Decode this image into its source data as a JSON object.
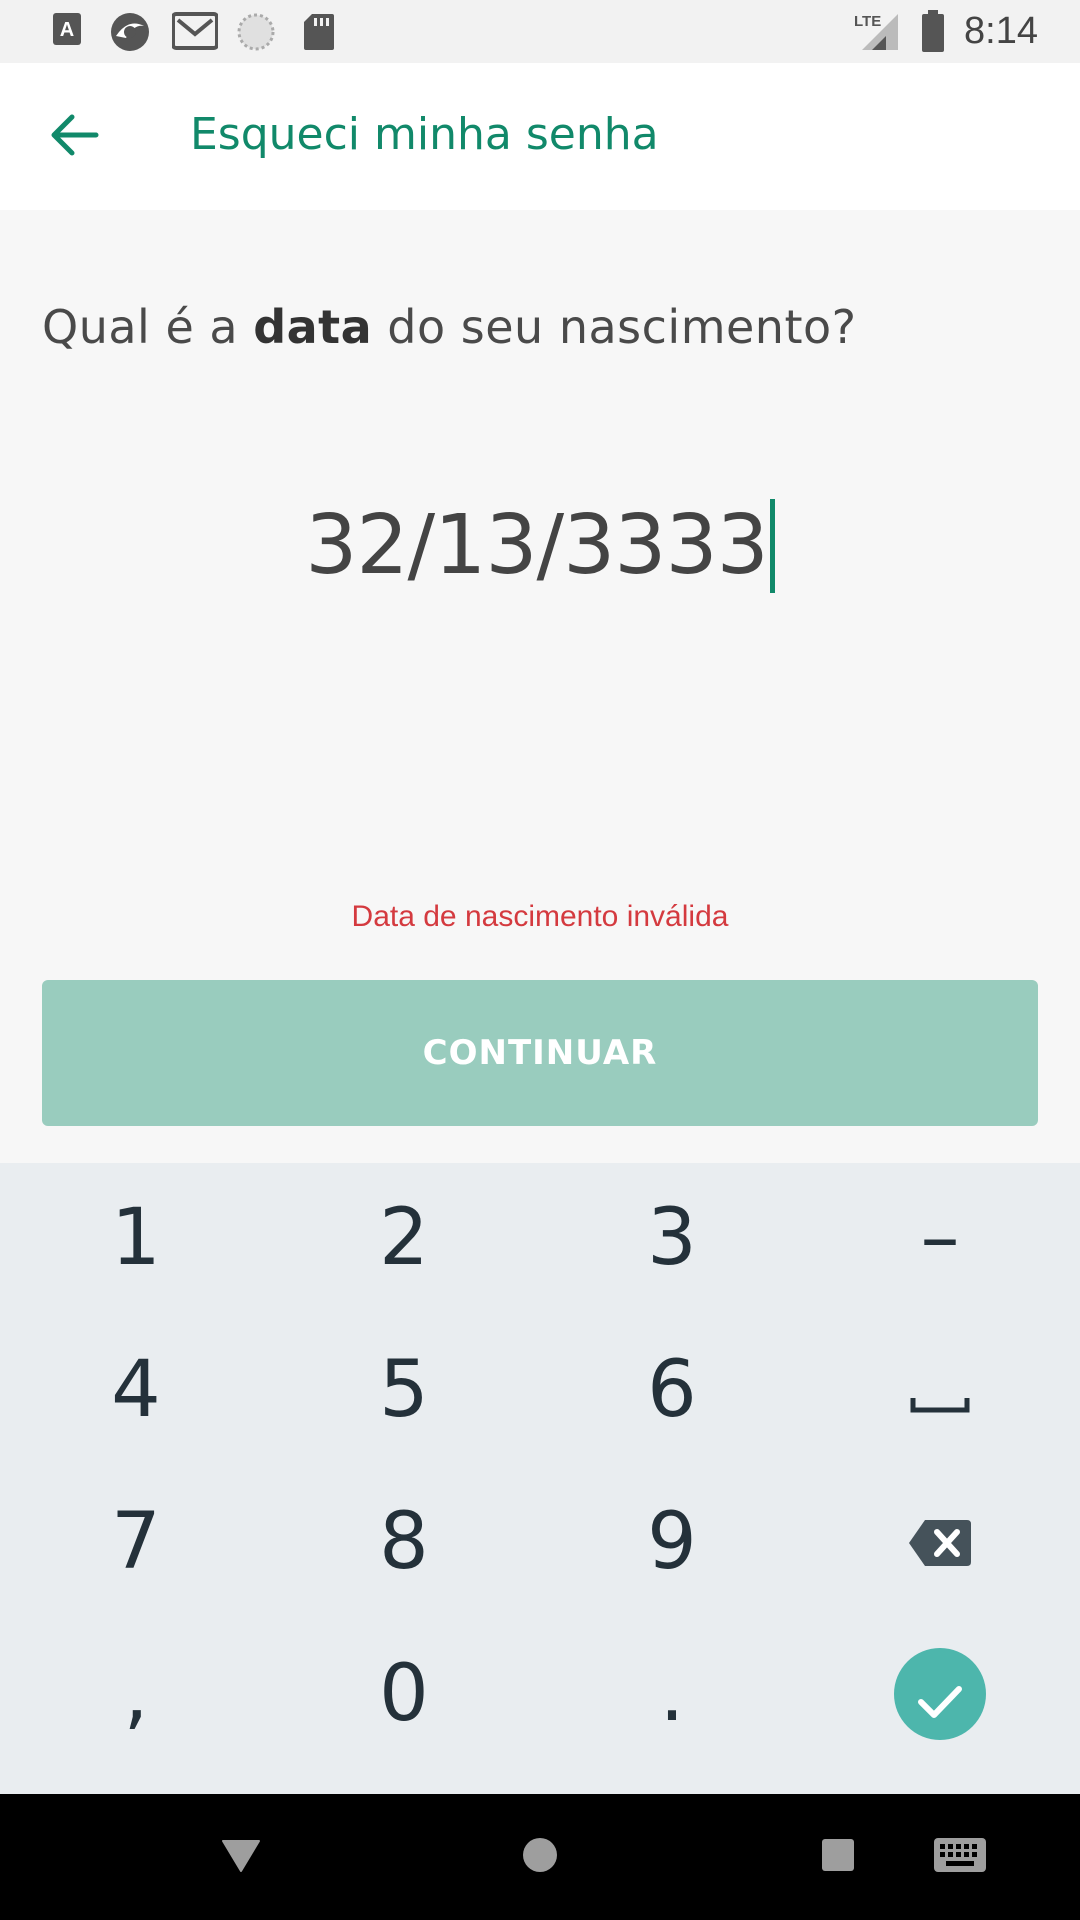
{
  "status_bar": {
    "time": "8:14",
    "network": "LTE",
    "icons": [
      "font-a-icon",
      "browser-icon",
      "gmail-icon",
      "loading-icon",
      "sd-card-icon",
      "signal-icon",
      "battery-icon"
    ]
  },
  "app_bar": {
    "title": "Esqueci minha senha",
    "back_icon": "arrow-left-icon"
  },
  "question": {
    "prefix": "Qual é a ",
    "bold": "data",
    "suffix": " do seu nascimento?"
  },
  "date_input": {
    "value": "32/13/3333"
  },
  "error_message": "Data de nascimento inválida",
  "continue_button": {
    "label": "CONTINUAR"
  },
  "keyboard": {
    "rows": [
      [
        "1",
        "2",
        "3",
        "–"
      ],
      [
        "4",
        "5",
        "6",
        "space-icon"
      ],
      [
        "7",
        "8",
        "9",
        "backspace-icon"
      ],
      [
        ",",
        "0",
        ".",
        "check-icon"
      ]
    ]
  },
  "nav_bar": {
    "buttons": [
      "back-triangle-icon",
      "home-circle-icon",
      "recents-square-icon",
      "keyboard-icon"
    ]
  },
  "colors": {
    "accent": "#11896a",
    "button_disabled": "#99ccbe",
    "error": "#d43a3f",
    "enter_key": "#4db6ac",
    "keyboard_bg": "#e9edf0"
  }
}
